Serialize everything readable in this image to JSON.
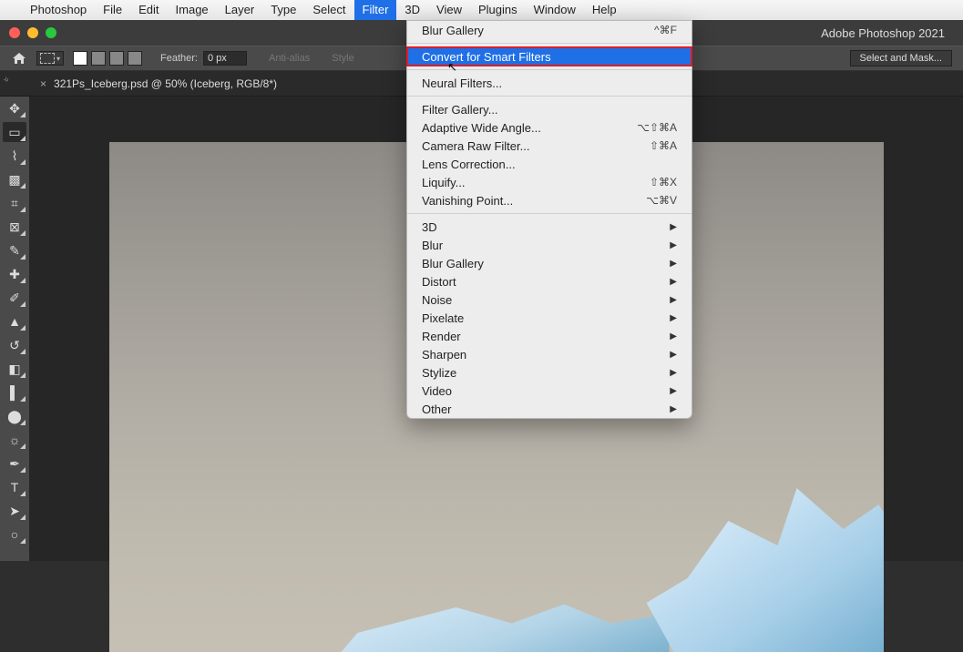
{
  "menubar": {
    "apple": "",
    "items": [
      "Photoshop",
      "File",
      "Edit",
      "Image",
      "Layer",
      "Type",
      "Select",
      "Filter",
      "3D",
      "View",
      "Plugins",
      "Window",
      "Help"
    ],
    "active_index": 7
  },
  "window": {
    "title": "Adobe Photoshop 2021"
  },
  "options": {
    "feather_label": "Feather:",
    "feather_value": "0 px",
    "anti_alias": "Anti-alias",
    "style": "Style",
    "select_and_mask": "Select and Mask..."
  },
  "doc_tab": {
    "label": "321Ps_Iceberg.psd @ 50% (Iceberg, RGB/8*)",
    "close": "×"
  },
  "tools": [
    {
      "name": "move-tool",
      "glyph": "✥"
    },
    {
      "name": "marquee-tool",
      "glyph": "▭",
      "selected": true
    },
    {
      "name": "lasso-tool",
      "glyph": "⌇"
    },
    {
      "name": "object-select-tool",
      "glyph": "▩"
    },
    {
      "name": "crop-tool",
      "glyph": "⌗"
    },
    {
      "name": "frame-tool",
      "glyph": "⊠"
    },
    {
      "name": "eyedropper-tool",
      "glyph": "✎"
    },
    {
      "name": "healing-brush-tool",
      "glyph": "✚"
    },
    {
      "name": "brush-tool",
      "glyph": "✐"
    },
    {
      "name": "clone-stamp-tool",
      "glyph": "▲"
    },
    {
      "name": "history-brush-tool",
      "glyph": "↺"
    },
    {
      "name": "eraser-tool",
      "glyph": "◧"
    },
    {
      "name": "gradient-tool",
      "glyph": "▌"
    },
    {
      "name": "blur-tool",
      "glyph": "⬤"
    },
    {
      "name": "dodge-tool",
      "glyph": "☼"
    },
    {
      "name": "pen-tool",
      "glyph": "✒"
    },
    {
      "name": "type-tool",
      "glyph": "T"
    },
    {
      "name": "path-select-tool",
      "glyph": "➤"
    },
    {
      "name": "shape-tool",
      "glyph": "○"
    }
  ],
  "filter_menu": {
    "recent": {
      "label": "Blur Gallery",
      "shortcut": "^⌘F"
    },
    "convert": {
      "label": "Convert for Smart Filters"
    },
    "neural": {
      "label": "Neural Filters..."
    },
    "gallery": {
      "label": "Filter Gallery..."
    },
    "adaptive": {
      "label": "Adaptive Wide Angle...",
      "shortcut": "⌥⇧⌘A"
    },
    "camera_raw": {
      "label": "Camera Raw Filter...",
      "shortcut": "⇧⌘A"
    },
    "lens": {
      "label": "Lens Correction..."
    },
    "liquify": {
      "label": "Liquify...",
      "shortcut": "⇧⌘X"
    },
    "vanishing": {
      "label": "Vanishing Point...",
      "shortcut": "⌥⌘V"
    },
    "submenus": [
      "3D",
      "Blur",
      "Blur Gallery",
      "Distort",
      "Noise",
      "Pixelate",
      "Render",
      "Sharpen",
      "Stylize",
      "Video",
      "Other"
    ]
  }
}
